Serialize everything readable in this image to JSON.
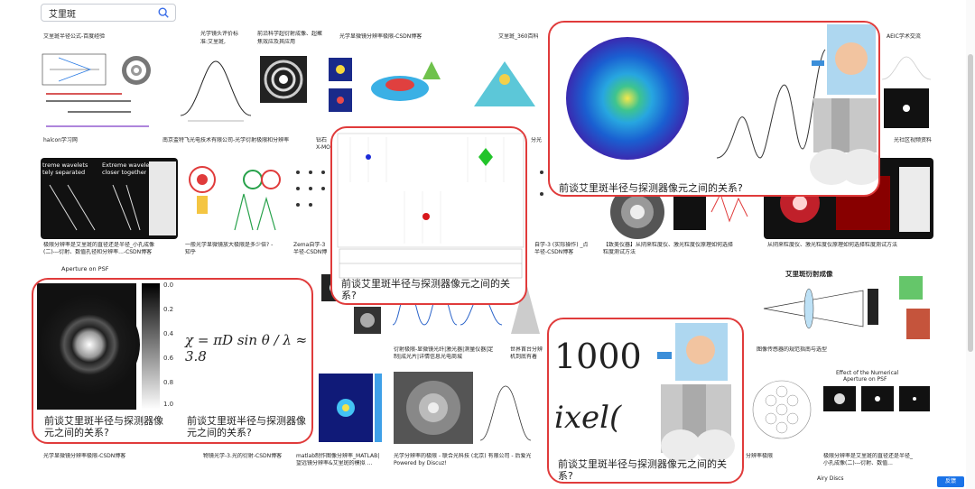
{
  "search": {
    "query": "艾里斑"
  },
  "captions": {
    "c1": "艾里斑半径公式-百度经验",
    "c2": "光学镜头评价标",
    "c2b": "准:艾里斑,",
    "c3": "前沿科学超衍射成像、超聚",
    "c3b": "焦效应及其应用",
    "c4": "光学显微镜分辨率极限-CSDN博客",
    "c5": "艾里斑_360百科",
    "c6": "AEIC学术交流",
    "c7": "halcon学习网",
    "c8": "南京盃特飞光电技术有限公司-光学衍射极限和分辨率",
    "c9": "钻石",
    "c9b": "X-MO",
    "c10": "分光",
    "c11": "光社区视频资料",
    "c12": "极限分辨率是艾里斑的直径还是半径_小孔成像",
    "c12b": "(二)---衍射、数值孔径和分辨率...-CSDN博客",
    "c13": "一般光学显微镜放大极限是多少倍? -",
    "c13b": "知乎",
    "c14": "Zema自学-3",
    "c14b": "半径-CSDN博",
    "c15": "自学-3 (实际操作) _点",
    "c15b": "半径-CSDN博客",
    "c16": "【致美仪器】从阴来粒度仪、激光粒度仪原理如何选择",
    "c16b": "粒度测试方法",
    "c17": "从阴来粒度仪、激光粒度仪原理如何选择粒度测试方法",
    "c18": "衍射极限-显微镜光纤|激光器|测量仪器|定",
    "c18b": "制|成光片|详情信息光电商城",
    "c19": "世界首台分辨",
    "c19b": "机到底有着",
    "c20": "图像传感器的规范指南与选型",
    "c21": "光学显微镜分辨率极限-CSDN博客",
    "c22": "物镜光学-3.光的衍射-CSDN博客",
    "c23": "matlab制作图像分辨率_MATLAB|",
    "c23b": "望远镜分辨率&艾里斑的模拟 ...",
    "c24": "光学分辨率的极限 - 联合光科技 (北京) 有限公司 - 后爱光",
    "c24b": "Powered by Discuz!",
    "c25": "分辨率极限",
    "c26": "极限分辨率是艾里斑的直径还是半径_",
    "c26b": "小孔成像(二)---衍射、数值..."
  },
  "cards": {
    "top_right": "前谈艾里斑半径与探测器像元之间的关系?",
    "center": "前谈艾里斑半径与探测器像元之间的关系?",
    "bottom_left_a": "前谈艾里斑半径与探测器像元之间的关系?",
    "bottom_left_b": "前谈艾里斑半径与探测器像元之间的关系?",
    "bottom_right": "前谈艾里斑半径与探测器像元之间的关系?"
  },
  "misc": {
    "formula": "χ = πD sin θ / λ ≈ 3.8",
    "big_num": "1000",
    "ixel": "ixel(",
    "airy_title": "艾里斑衍射成像",
    "aperture_psf": "Aperture on PSF",
    "airy_discs": "Airy Discs",
    "extreme1": "treme wavelets",
    "extreme1b": "tely separated",
    "extreme2": "Extreme wavele",
    "extreme2b": "closer together",
    "effect_title": "Effect of the Numerical",
    "effect_title2": "Aperture on PSF",
    "feedback": "反馈"
  },
  "colors": {
    "highlight": "#e03b3b",
    "accent": "#1a73e8"
  }
}
